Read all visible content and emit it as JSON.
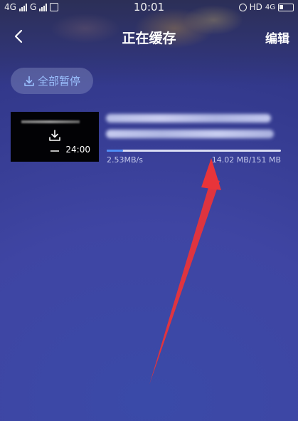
{
  "status_bar": {
    "network_1": "4G",
    "network_2": "G",
    "time": "10:01",
    "hd": "HD",
    "network_3": "4G"
  },
  "header": {
    "title": "正在缓存",
    "edit_label": "编辑"
  },
  "toolbar": {
    "pause_all_label": "全部暂停"
  },
  "download_item": {
    "duration": "24:00",
    "speed": "2.53MB/s",
    "size": "14.02 MB/151 MB",
    "progress_fraction": 0.093
  },
  "colors": {
    "accent": "#4f8df5",
    "pause_text": "#9cc2ff",
    "annotation_arrow": "#e8343a"
  }
}
